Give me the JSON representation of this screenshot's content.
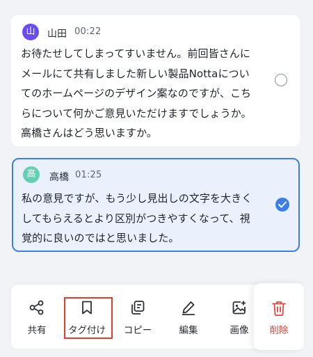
{
  "messages": [
    {
      "avatar": "山",
      "speaker": "山田",
      "time": "00:22",
      "text": "お待たせしてしまってすいません。前回皆さんに\nメールにて共有しました新しい製品Nottaについ\nてのホームページのデザイン案なのですが、こち\nらについて何かご意見いただけますでしょうか。\n高橋さんはどう思いますか。",
      "selected": false
    },
    {
      "avatar": "高",
      "speaker": "高橋",
      "time": "01:25",
      "text": "私の意見ですが、もう少し見出しの文字を大きく\nしてもらえるとより区別がつきやすくなって、視\n覚的に良いのではと思いました。",
      "selected": true
    }
  ],
  "toolbar": {
    "share": "共有",
    "tag": "タグ付け",
    "copy": "コピー",
    "edit": "編集",
    "image": "画像",
    "delete": "削除"
  },
  "colors": {
    "accent": "#3b7ee8",
    "danger": "#e0453a",
    "highlight_border": "#e5392b",
    "avatar_yamada": "#6a4cf0",
    "avatar_takahashi": "#64cfb3"
  },
  "icons": {
    "share": "share-icon",
    "tag": "bookmark-icon",
    "copy": "copy-icon",
    "edit": "pencil-icon",
    "image": "image-add-icon",
    "delete": "trash-icon",
    "selected": "check-circle-icon",
    "unselected": "radio-icon"
  }
}
